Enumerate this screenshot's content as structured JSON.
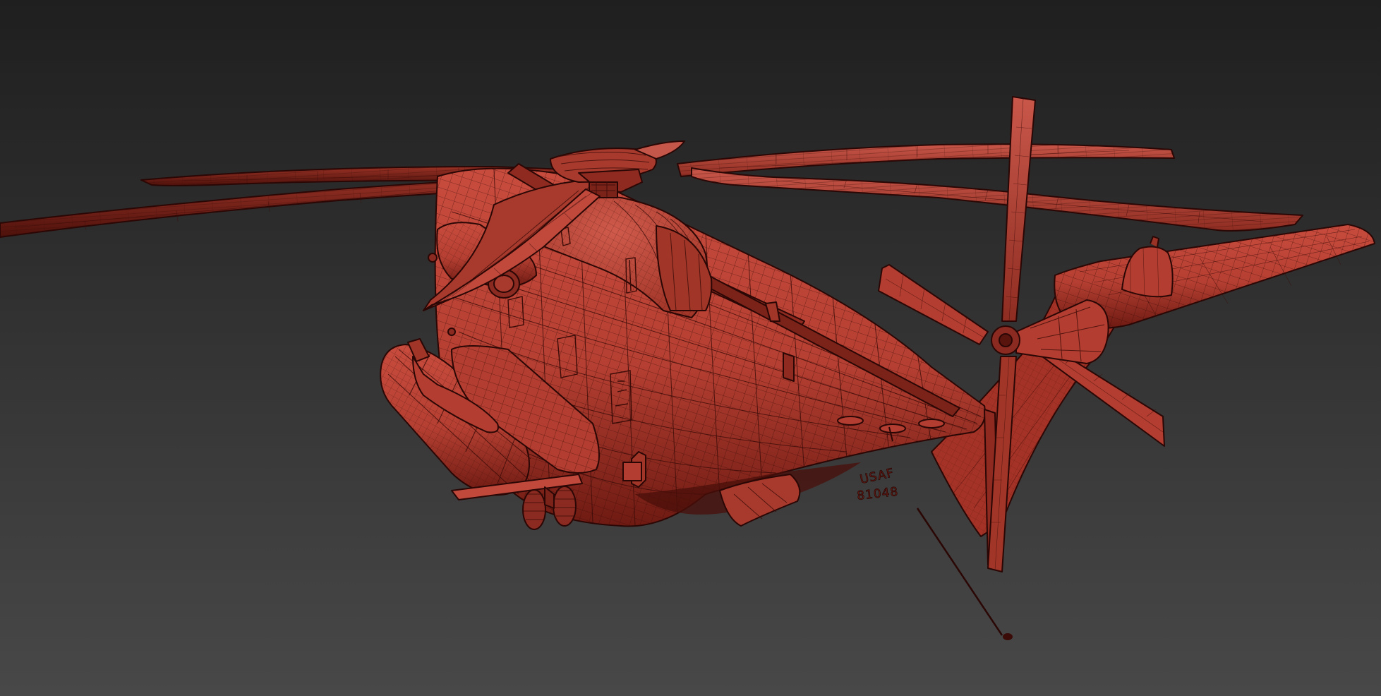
{
  "scene": {
    "subject": "helicopter-wireframe-model",
    "colors": {
      "background_top": "#1f1f1f",
      "background_bottom": "#474747",
      "model_base": "#c4483a",
      "model_shade": "#8e2a20",
      "model_dark": "#5a140e",
      "wire": "#3a0b07"
    },
    "markings": {
      "service": "USAF",
      "serial": "81048"
    }
  }
}
